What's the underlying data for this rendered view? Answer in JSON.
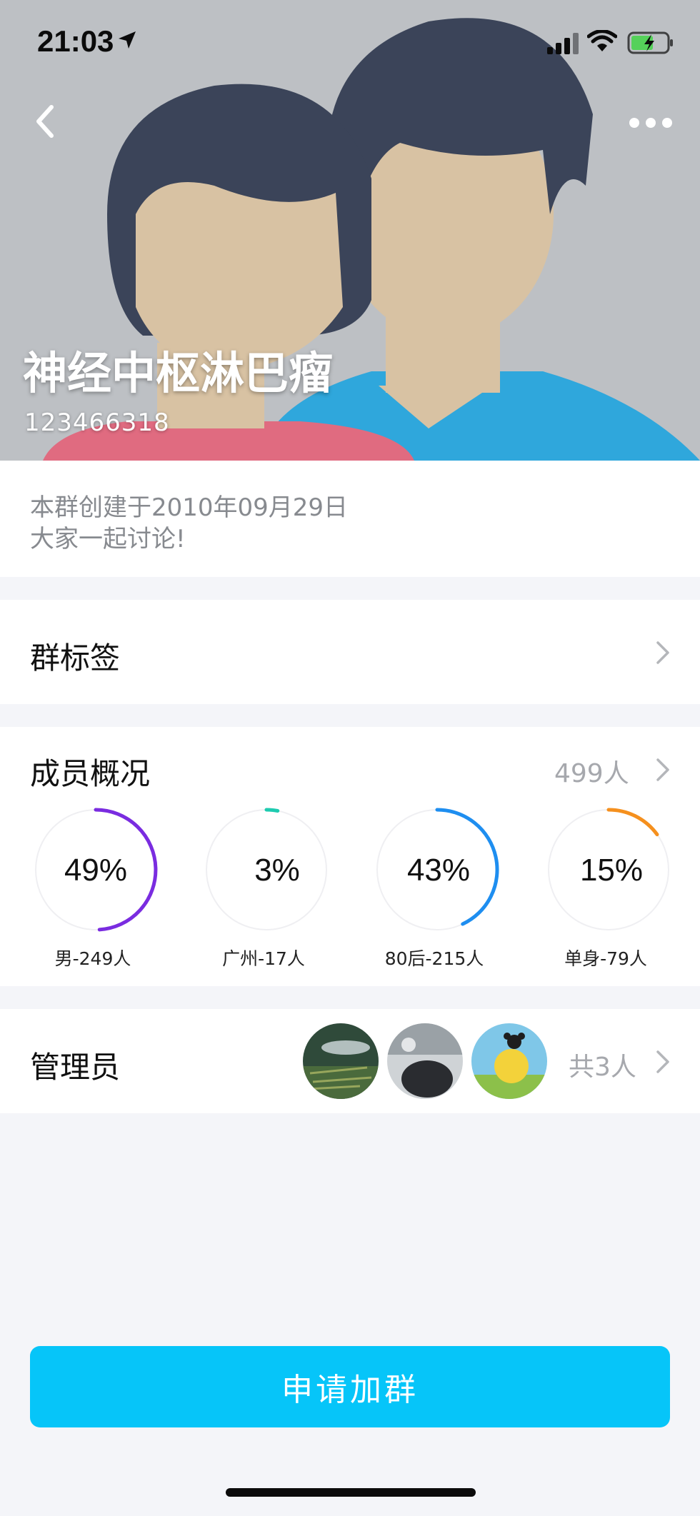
{
  "status_bar": {
    "time": "21:03"
  },
  "header": {
    "group_name": "神经中枢淋巴瘤",
    "group_id": "123466318"
  },
  "description": {
    "line1": "本群创建于2010年09月29日",
    "line2": "大家一起讨论!"
  },
  "tags_row": {
    "label": "群标签"
  },
  "members": {
    "label": "成员概况",
    "count": "499人",
    "stats": [
      {
        "pct_text": "49%",
        "caption": "男-249人",
        "fraction": 0.49,
        "color": "#7a2ce0"
      },
      {
        "pct_text": "3%",
        "caption": "广州-17人",
        "fraction": 0.03,
        "color": "#1ecbb0"
      },
      {
        "pct_text": "43%",
        "caption": "80后-215人",
        "fraction": 0.43,
        "color": "#1e8ef0"
      },
      {
        "pct_text": "15%",
        "caption": "单身-79人",
        "fraction": 0.15,
        "color": "#f5901e"
      }
    ]
  },
  "admins": {
    "label": "管理员",
    "count": "共3人"
  },
  "action": {
    "apply_label": "申请加群"
  }
}
